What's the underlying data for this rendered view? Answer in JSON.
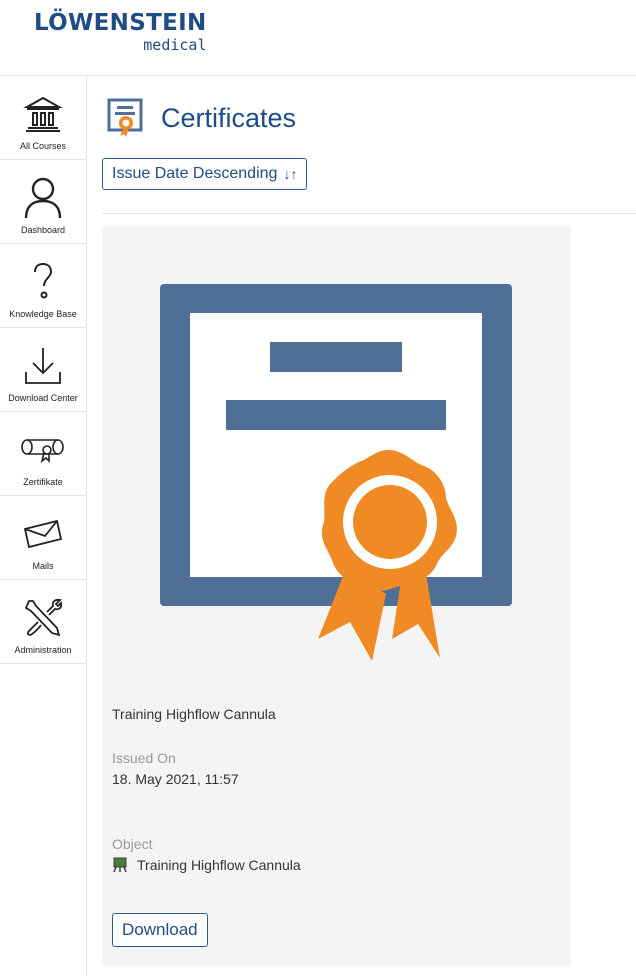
{
  "brand": {
    "name": "LÖWENSTEIN",
    "sub": "medical"
  },
  "sidebar": {
    "items": [
      {
        "label": "All Courses",
        "icon": "courses-building-icon"
      },
      {
        "label": "Dashboard",
        "icon": "user-icon"
      },
      {
        "label": "Knowledge Base",
        "icon": "question-mark-icon"
      },
      {
        "label": "Download Center",
        "icon": "download-icon"
      },
      {
        "label": "Zertifikate",
        "icon": "certificate-scroll-icon"
      },
      {
        "label": "Mails",
        "icon": "envelope-icon"
      },
      {
        "label": "Administration",
        "icon": "tools-icon"
      }
    ]
  },
  "page": {
    "title": "Certificates",
    "sort_label": "Issue Date Descending",
    "sort_icon": "↓↑"
  },
  "certificate": {
    "name": "Training Highflow Cannula",
    "issued_label": "Issued On",
    "issued_value": "18. May 2021, 11:57",
    "object_label": "Object",
    "object_value": "Training Highflow Cannula",
    "download_label": "Download"
  },
  "colors": {
    "brand_blue": "#1f4c85",
    "certificate_frame": "#4f6f97",
    "ribbon_orange": "#f08a24"
  }
}
